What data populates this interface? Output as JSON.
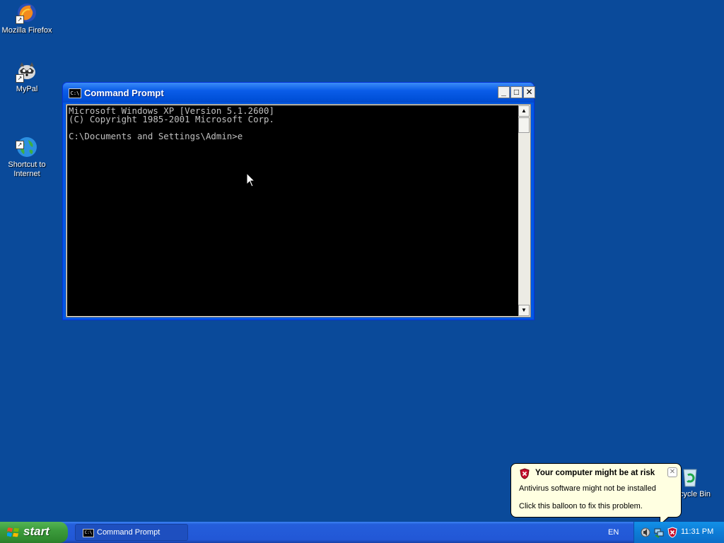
{
  "desktop": {
    "icons": [
      {
        "label": "Mozilla Firefox",
        "icon": "firefox-icon"
      },
      {
        "label": "MyPal",
        "icon": "raccoon-icon"
      },
      {
        "label": "Shortcut to\nInternet",
        "icon": "globe-icon"
      },
      {
        "label": "Recycle Bin",
        "icon": "recycle-bin-icon"
      }
    ]
  },
  "window": {
    "title": "Command Prompt",
    "console_text": "Microsoft Windows XP [Version 5.1.2600]\n(C) Copyright 1985-2001 Microsoft Corp.\n\nC:\\Documents and Settings\\Admin>e"
  },
  "balloon": {
    "title": "Your computer might be at risk",
    "line1": "Antivirus software might not be installed",
    "line2": "Click this balloon to fix this problem."
  },
  "taskbar": {
    "start_label": "start",
    "task_label": "Command Prompt",
    "language": "EN",
    "clock": "11:31 PM"
  },
  "colors": {
    "desktop": "#0a4a9a",
    "titlebar": "#0058e6",
    "taskbar": "#245edb",
    "start": "#3c9c3c",
    "balloon": "#ffffe1"
  }
}
